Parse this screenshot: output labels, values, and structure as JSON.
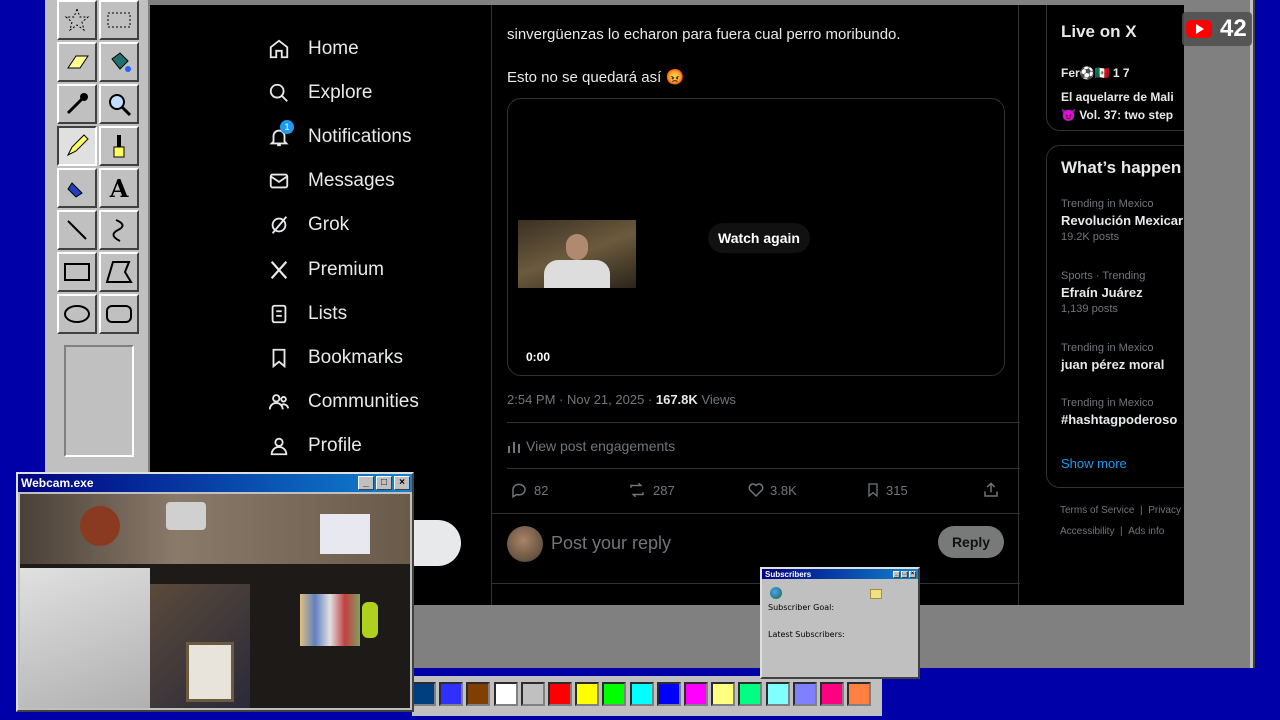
{
  "paint": {
    "tools": [
      "free-select",
      "rect-select",
      "eraser",
      "fill",
      "color-picker",
      "magnifier",
      "pencil",
      "brush",
      "airbrush",
      "text",
      "line",
      "curve",
      "rectangle",
      "polygon",
      "ellipse",
      "rounded-rectangle"
    ],
    "text_tool_glyph": "A",
    "palette": [
      "#003f7f",
      "#2f2fff",
      "#7f3f00",
      "#ffffff",
      "#c0c0c0",
      "#ff0000",
      "#ffff00",
      "#00ff00",
      "#00ffff",
      "#0000ff",
      "#ff00ff",
      "#ffff80",
      "#00ff80",
      "#80ffff",
      "#8080ff",
      "#ff0080",
      "#ff8040"
    ]
  },
  "x_nav": {
    "items": [
      {
        "label": "Home",
        "icon": "home-icon"
      },
      {
        "label": "Explore",
        "icon": "search-icon"
      },
      {
        "label": "Notifications",
        "icon": "bell-icon",
        "badge": "1"
      },
      {
        "label": "Messages",
        "icon": "mail-icon"
      },
      {
        "label": "Grok",
        "icon": "grok-icon"
      },
      {
        "label": "Premium",
        "icon": "x-logo-icon"
      },
      {
        "label": "Lists",
        "icon": "list-icon"
      },
      {
        "label": "Bookmarks",
        "icon": "bookmark-icon"
      },
      {
        "label": "Communities",
        "icon": "people-icon"
      },
      {
        "label": "Profile",
        "icon": "person-icon"
      }
    ]
  },
  "post": {
    "text_line1": "sinvergüenzas lo echaron para fuera cual perro moribundo.",
    "text_line2": "Esto no se quedará así",
    "emoji": "😡",
    "video_watch_again": "Watch again",
    "video_time": "0:00",
    "meta_time": "2:54 PM · Nov 21, 2025 · ",
    "views_count": "167.8K",
    "views_label": " Views",
    "engagements": "View post engagements",
    "replies": "82",
    "reposts": "287",
    "likes": "3.8K",
    "bookmarks": "315",
    "reply_placeholder": "Post your reply",
    "reply_button": "Reply"
  },
  "sidebar": {
    "live_title": "Live on X",
    "live_user": "Fer⚽🇲🇽 1 7",
    "live_line1": "El aquelarre de Mali",
    "live_line2": "Vol. 37: two step",
    "live_emoji": "😈",
    "happening_title": "What’s happen",
    "trends": [
      {
        "context": "Trending in Mexico",
        "name": "Revolución Mexicar",
        "posts": "19.2K posts"
      },
      {
        "context": "Sports · Trending",
        "name": "Efraín Juárez",
        "posts": "1,139 posts"
      },
      {
        "context": "Trending in Mexico",
        "name": "juan pérez moral",
        "posts": ""
      },
      {
        "context": "Trending in Mexico",
        "name": "#hashtagpoderoso",
        "posts": ""
      }
    ],
    "show_more": "Show more",
    "footer1": "Terms of Service",
    "footer1b": "Privacy",
    "footer2": "Accessibility",
    "footer2b": "Ads info"
  },
  "youtube_counter": "42",
  "webcam": {
    "title": "Webcam.exe"
  },
  "subscribers": {
    "title": "Subscribers",
    "goal_label": "Subscriber Goal:",
    "latest_label": "Latest Subscribers:"
  }
}
